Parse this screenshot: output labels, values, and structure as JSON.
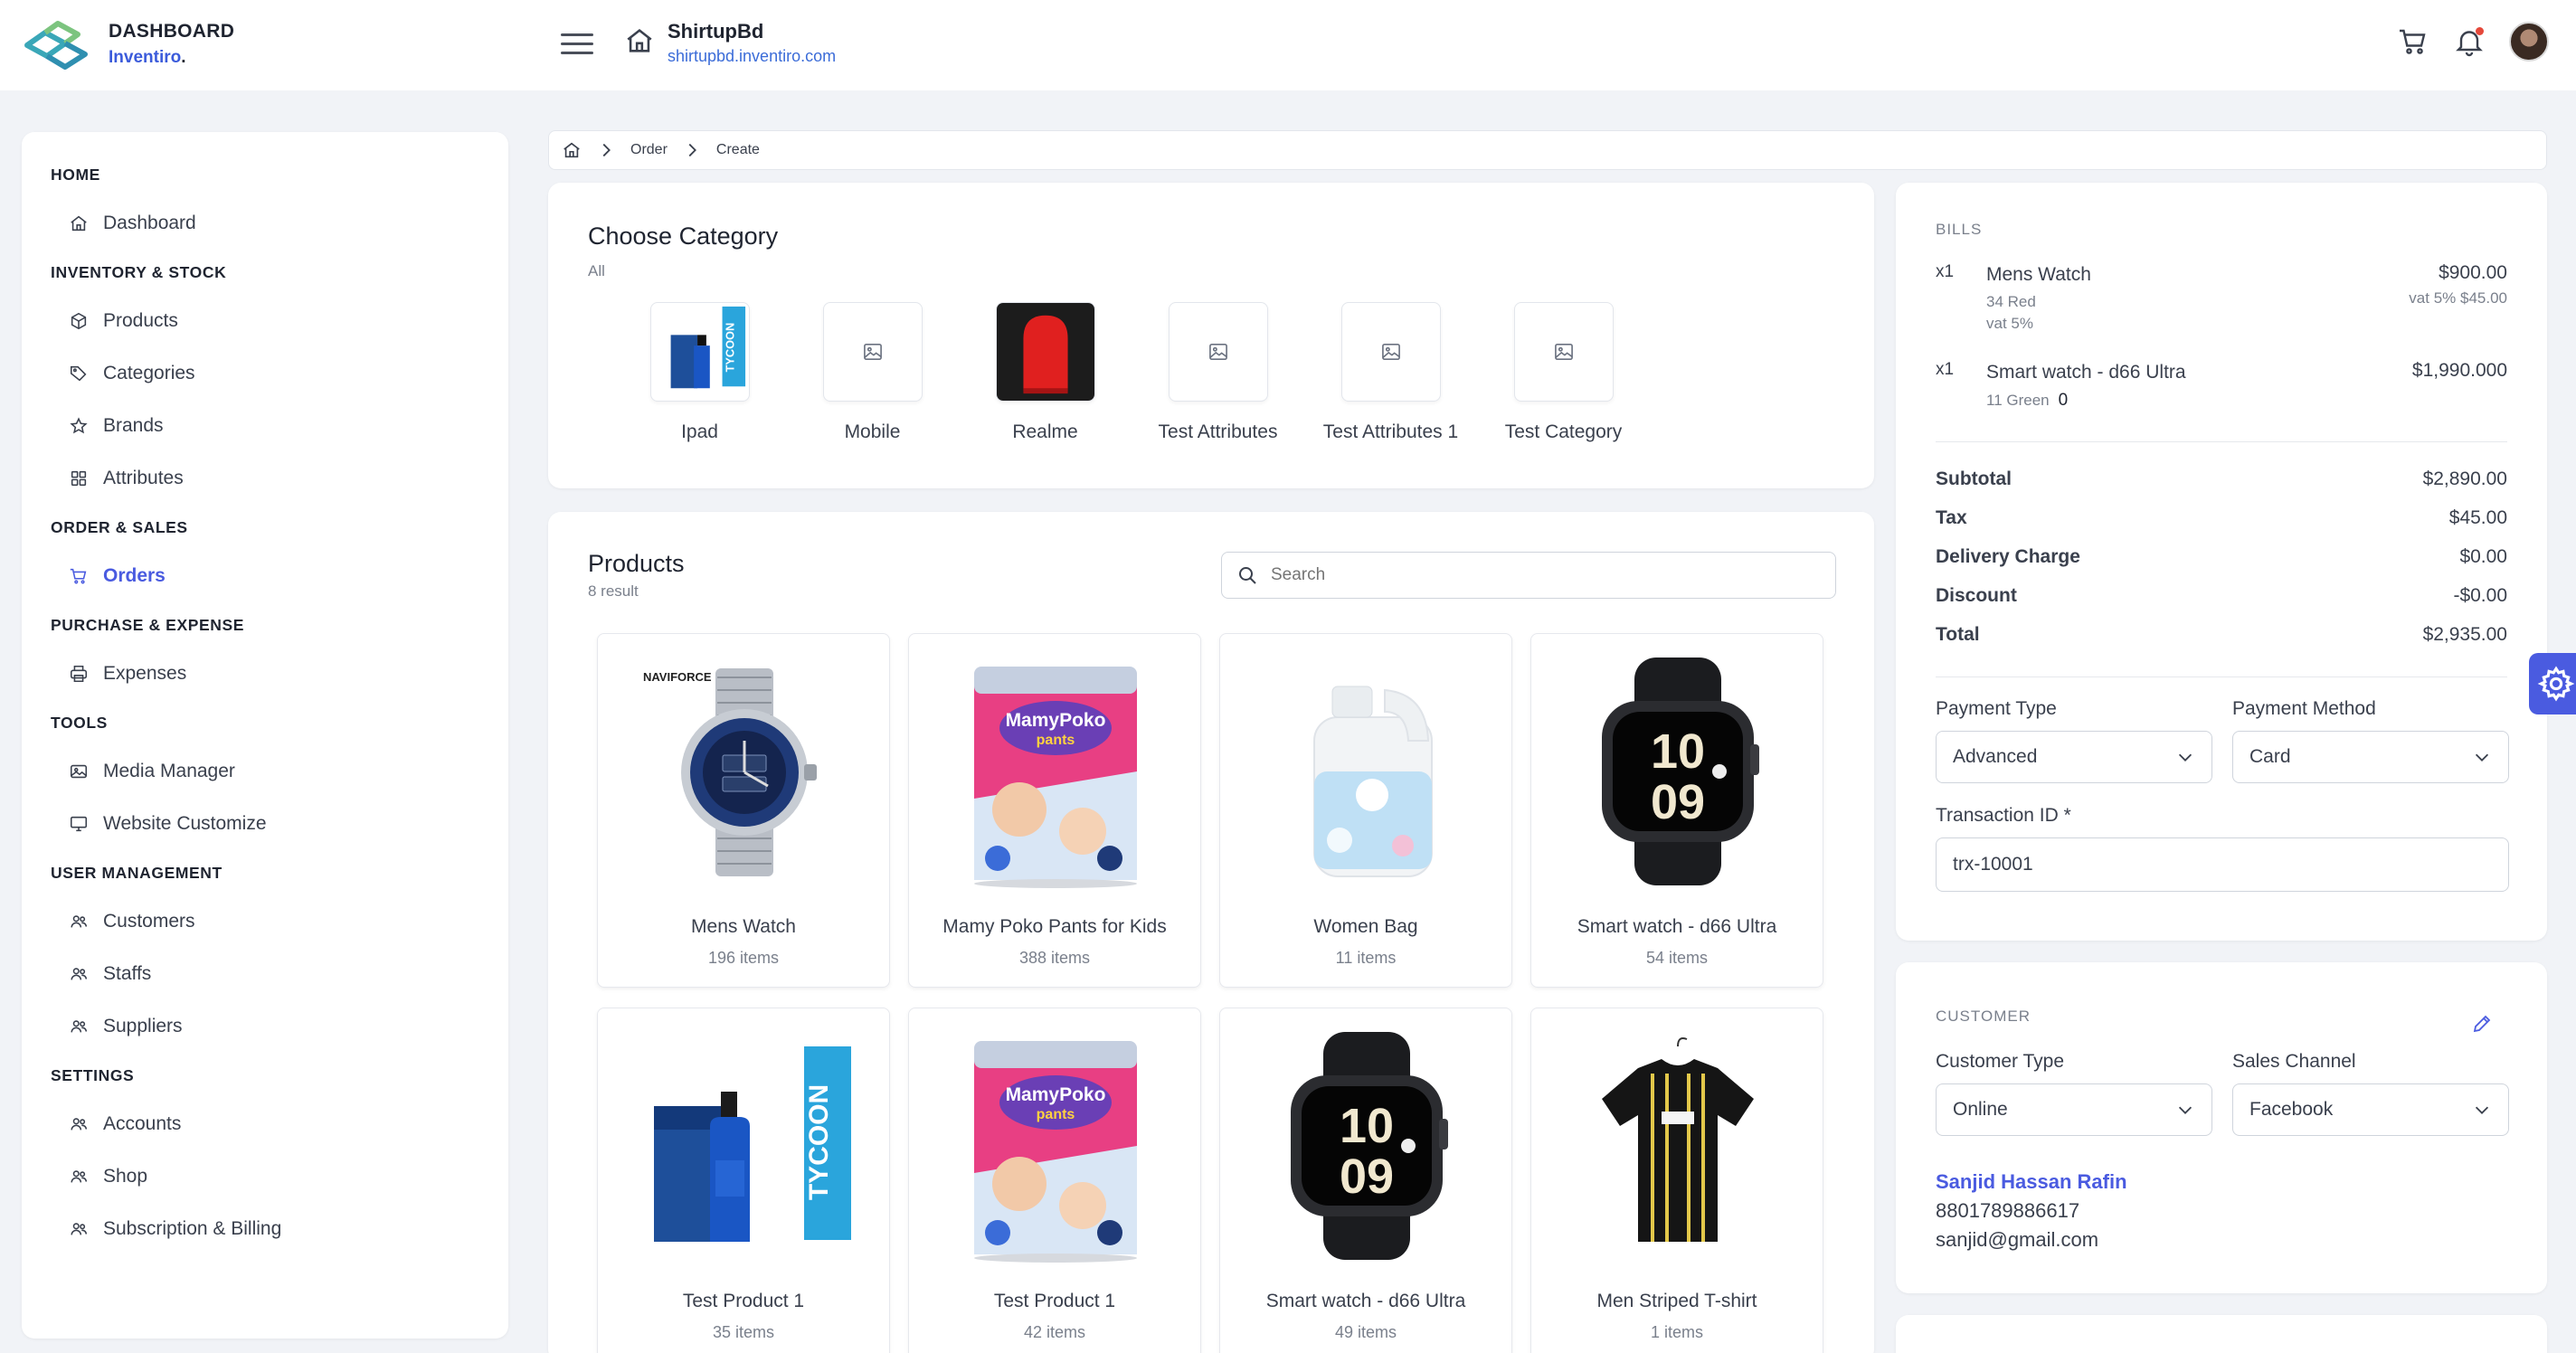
{
  "header": {
    "brand_title": "DASHBOARD",
    "brand_sub": "Inventiro",
    "brand_dot": ".",
    "shop_name": "ShirtupBd",
    "shop_url": "shirtupbd.inventiro.com"
  },
  "sidebar": {
    "sections": [
      {
        "title": "HOME",
        "items": [
          {
            "label": "Dashboard",
            "icon": "home-icon"
          }
        ]
      },
      {
        "title": "INVENTORY & STOCK",
        "items": [
          {
            "label": "Products",
            "icon": "box-icon"
          },
          {
            "label": "Categories",
            "icon": "tag-icon"
          },
          {
            "label": "Brands",
            "icon": "star-icon"
          },
          {
            "label": "Attributes",
            "icon": "grid-icon"
          }
        ]
      },
      {
        "title": "ORDER & SALES",
        "items": [
          {
            "label": "Orders",
            "icon": "cart-icon",
            "active": true
          }
        ]
      },
      {
        "title": "PURCHASE & EXPENSE",
        "items": [
          {
            "label": "Expenses",
            "icon": "printer-icon"
          }
        ]
      },
      {
        "title": "TOOLS",
        "items": [
          {
            "label": "Media Manager",
            "icon": "image-icon"
          },
          {
            "label": "Website Customize",
            "icon": "monitor-icon"
          }
        ]
      },
      {
        "title": "USER MANAGEMENT",
        "items": [
          {
            "label": "Customers",
            "icon": "users-icon"
          },
          {
            "label": "Staffs",
            "icon": "users-icon"
          },
          {
            "label": "Suppliers",
            "icon": "users-icon"
          }
        ]
      },
      {
        "title": "SETTINGS",
        "items": [
          {
            "label": "Accounts",
            "icon": "users-icon"
          },
          {
            "label": "Shop",
            "icon": "users-icon"
          },
          {
            "label": "Subscription & Billing",
            "icon": "users-icon"
          }
        ]
      }
    ]
  },
  "breadcrumb": {
    "items": [
      "Order",
      "Create"
    ]
  },
  "categories": {
    "title": "Choose Category",
    "subtitle": "All",
    "items": [
      {
        "label": "Ipad",
        "image": "perfume"
      },
      {
        "label": "Mobile",
        "image": "placeholder"
      },
      {
        "label": "Realme",
        "image": "red-product"
      },
      {
        "label": "Test Attributes",
        "image": "placeholder"
      },
      {
        "label": "Test Attributes 1",
        "image": "placeholder"
      },
      {
        "label": "Test Category",
        "image": "placeholder"
      }
    ]
  },
  "products": {
    "title": "Products",
    "count": "8 result",
    "search_placeholder": "Search",
    "items": [
      {
        "name": "Mens Watch",
        "count": "196 items",
        "image": "watch",
        "brand_mark": "NAVIFORCE"
      },
      {
        "name": "Mamy Poko Pants for Kids",
        "count": "388 items",
        "image": "diapers",
        "brand_mark": "MamyPoko pants"
      },
      {
        "name": "Women Bag",
        "count": "11 items",
        "image": "jug"
      },
      {
        "name": "Smart watch - d66 Ultra",
        "count": "54 items",
        "image": "smartwatch",
        "brand_mark": "10 09"
      },
      {
        "name": "Test Product 1",
        "count": "35 items",
        "image": "perfume",
        "brand_mark": "TYCOON"
      },
      {
        "name": "Test Product 1",
        "count": "42 items",
        "image": "diapers",
        "brand_mark": "MamyPoko pants"
      },
      {
        "name": "Smart watch - d66 Ultra",
        "count": "49 items",
        "image": "smartwatch",
        "brand_mark": "10 09"
      },
      {
        "name": "Men Striped T-shirt",
        "count": "1 items",
        "image": "tshirt"
      }
    ]
  },
  "bills": {
    "title": "BILLS",
    "items": [
      {
        "qty": "x1",
        "name": "Mens Watch",
        "meta": "34  Red",
        "meta2": "vat 5%",
        "price": "$900.00",
        "vat": "vat 5% $45.00"
      },
      {
        "qty": "x1",
        "name": "Smart watch - d66 Ultra",
        "meta": "11  Green",
        "meta_extra": "0",
        "price": "$1,990.000"
      }
    ],
    "summary": [
      {
        "label": "Subtotal",
        "value": "$2,890.00"
      },
      {
        "label": "Tax",
        "value": "$45.00"
      },
      {
        "label": "Delivery Charge",
        "value": "$0.00"
      },
      {
        "label": "Discount",
        "value": "-$0.00"
      },
      {
        "label": "Total",
        "value": "$2,935.00"
      }
    ],
    "payment_type_label": "Payment Type",
    "payment_type_value": "Advanced",
    "payment_method_label": "Payment Method",
    "payment_method_value": "Card",
    "transaction_label": "Transaction ID *",
    "transaction_value": "trx-10001"
  },
  "customer": {
    "title": "CUSTOMER",
    "type_label": "Customer Type",
    "type_value": "Online",
    "channel_label": "Sales Channel",
    "channel_value": "Facebook",
    "name": "Sanjid Hassan Rafin",
    "phone": "8801789886617",
    "email": "sanjid@gmail.com"
  },
  "colors": {
    "accent": "#4a5be0",
    "link": "#3b6cd8",
    "notification": "#e5483a"
  }
}
